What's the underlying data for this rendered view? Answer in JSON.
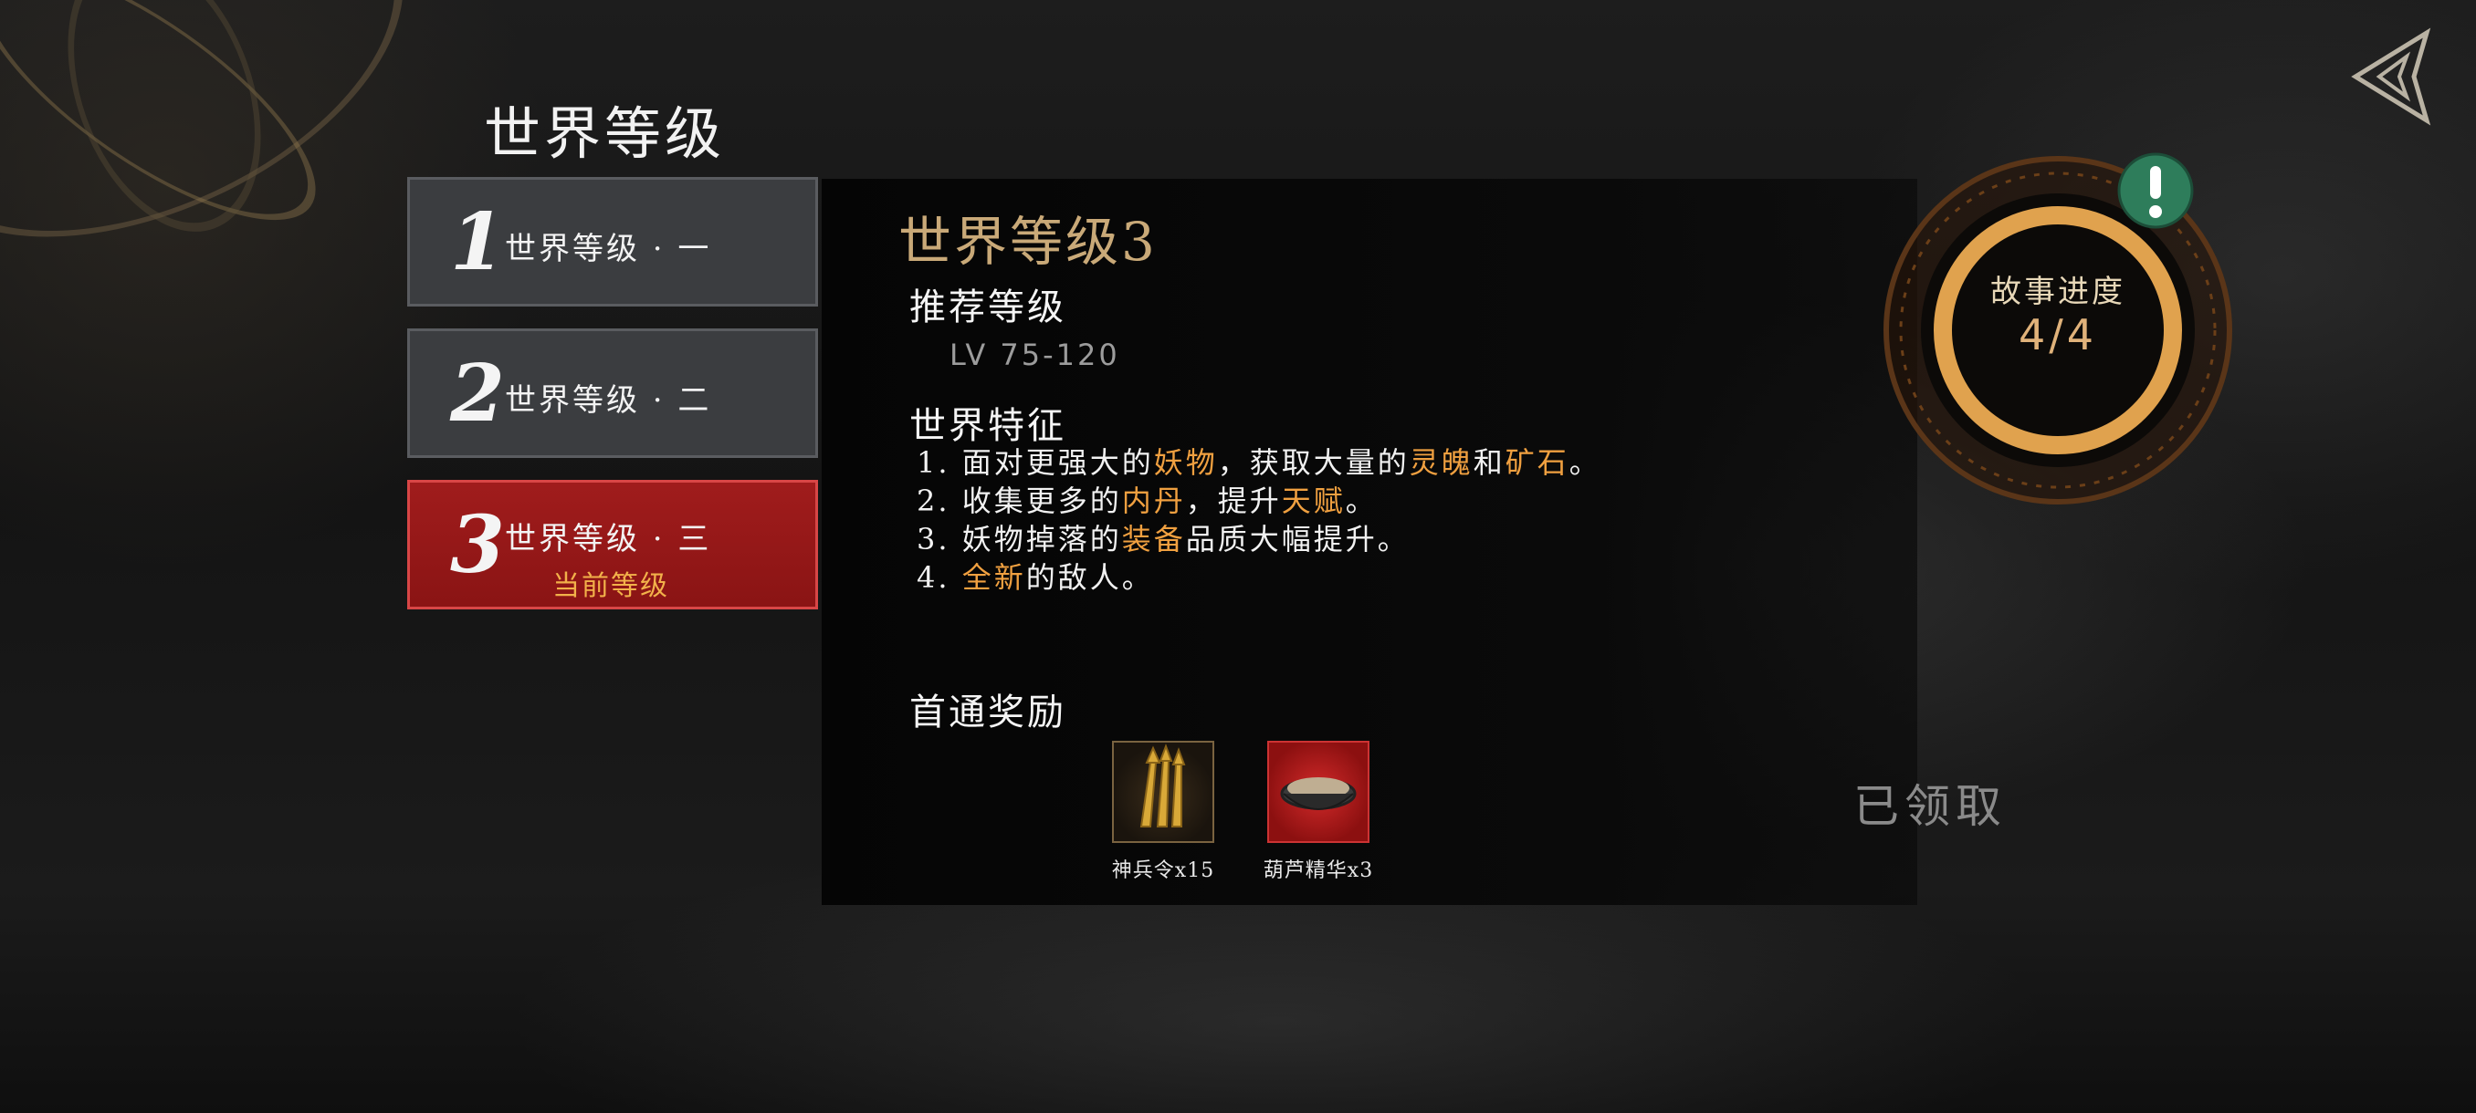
{
  "page": {
    "title": "世界等级"
  },
  "levels": [
    {
      "number": "1",
      "label": "世界等级 · 一",
      "sub": ""
    },
    {
      "number": "2",
      "label": "世界等级 · 二",
      "sub": ""
    },
    {
      "number": "3",
      "label": "世界等级 · 三",
      "sub": "当前等级"
    }
  ],
  "detail": {
    "title": "世界等级3",
    "recommended_heading": "推荐等级",
    "level_range": "LV 75-120",
    "features_heading": "世界特征",
    "features": [
      {
        "n": "1. ",
        "p1": "面对更强大的",
        "h1": "妖物",
        "p2": "，获取大量的",
        "h2": "灵魄",
        "p3": "和",
        "h3": "矿石",
        "p4": "。"
      },
      {
        "n": "2. ",
        "p1": "收集更多的",
        "h1": "内丹",
        "p2": "，提升",
        "h2": "天赋",
        "p3": "。"
      },
      {
        "n": "3. ",
        "p1": "妖物掉落的",
        "h1": "装备",
        "p2": "品质大幅提升。"
      },
      {
        "n": "4. ",
        "h1": "全新",
        "p1": "的敌人。"
      }
    ],
    "reward_heading": "首通奖励",
    "rewards": [
      {
        "name": "神兵令x15",
        "icon": "golden-arrows-icon"
      },
      {
        "name": "葫芦精华x3",
        "icon": "essence-bowl-icon"
      }
    ],
    "claimed_label": "已领取"
  },
  "story": {
    "label": "故事进度",
    "value": "4/4",
    "progress": 1.0
  },
  "colors": {
    "accent_gold": "#c9a978",
    "highlight": "#f0a040",
    "active_red": "#a01c1c",
    "badge_green": "#2e7d5b"
  }
}
